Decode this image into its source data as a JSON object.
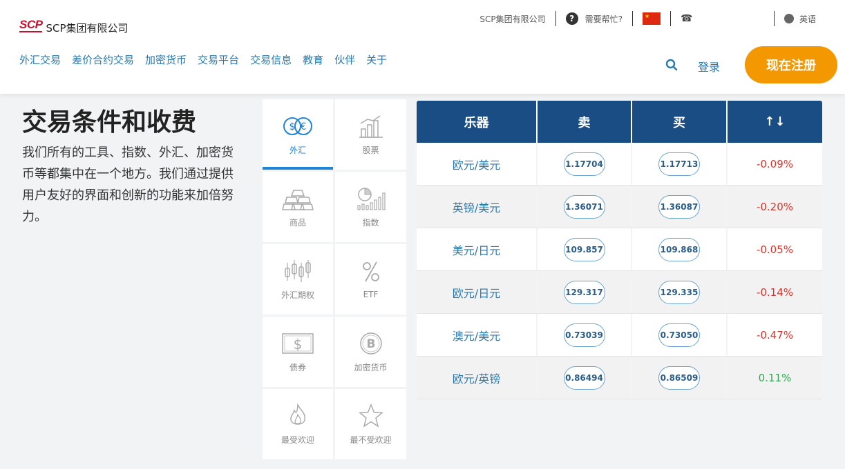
{
  "header": {
    "logo_mark": "SCP",
    "logo_text": "SCP集团有限公司",
    "topbar": {
      "company": "SCP集团有限公司",
      "help": "需要帮忙?",
      "language": "英语"
    },
    "nav": [
      "外汇交易",
      "差价合约交易",
      "加密货币",
      "交易平台",
      "交易信息",
      "教育",
      "伙伴",
      "关于"
    ],
    "login": "登录",
    "register": "现在注册"
  },
  "hero": {
    "title": "交易条件和收费",
    "description": "我们所有的工具、指数、外汇、加密货币等都集中在一个地方。我们通过提供用户友好的界面和创新的功能来加倍努力。"
  },
  "categories": [
    {
      "label": "外汇",
      "icon": "forex-icon",
      "active": true
    },
    {
      "label": "股票",
      "icon": "stocks-icon",
      "active": false
    },
    {
      "label": "商品",
      "icon": "commodities-icon",
      "active": false
    },
    {
      "label": "指数",
      "icon": "indices-icon",
      "active": false
    },
    {
      "label": "外汇期权",
      "icon": "candlestick-icon",
      "active": false
    },
    {
      "label": "ETF",
      "icon": "percent-icon",
      "active": false
    },
    {
      "label": "债券",
      "icon": "bond-icon",
      "active": false
    },
    {
      "label": "加密货币",
      "icon": "bitcoin-icon",
      "active": false
    },
    {
      "label": "最受欢迎",
      "icon": "fire-icon",
      "active": false
    },
    {
      "label": "最不受欢迎",
      "icon": "star-icon",
      "active": false
    }
  ],
  "table": {
    "headers": [
      "乐器",
      "卖",
      "买",
      "↑↓"
    ],
    "rows": [
      {
        "pair": "欧元/美元",
        "sell": "1.17704",
        "buy": "1.17713",
        "change": "-0.09%",
        "dir": "neg"
      },
      {
        "pair": "英镑/美元",
        "sell": "1.36071",
        "buy": "1.36087",
        "change": "-0.20%",
        "dir": "neg"
      },
      {
        "pair": "美元/日元",
        "sell": "109.857",
        "buy": "109.868",
        "change": "-0.05%",
        "dir": "neg"
      },
      {
        "pair": "欧元/日元",
        "sell": "129.317",
        "buy": "129.335",
        "change": "-0.14%",
        "dir": "neg"
      },
      {
        "pair": "澳元/美元",
        "sell": "0.73039",
        "buy": "0.73050",
        "change": "-0.47%",
        "dir": "neg"
      },
      {
        "pair": "欧元/英镑",
        "sell": "0.86494",
        "buy": "0.86509",
        "change": "0.11%",
        "dir": "pos"
      }
    ]
  },
  "colors": {
    "accent": "#f39800",
    "table_header": "#1b4d85",
    "link": "#2a7ab0",
    "negative": "#d9342b",
    "positive": "#2fa84f"
  }
}
